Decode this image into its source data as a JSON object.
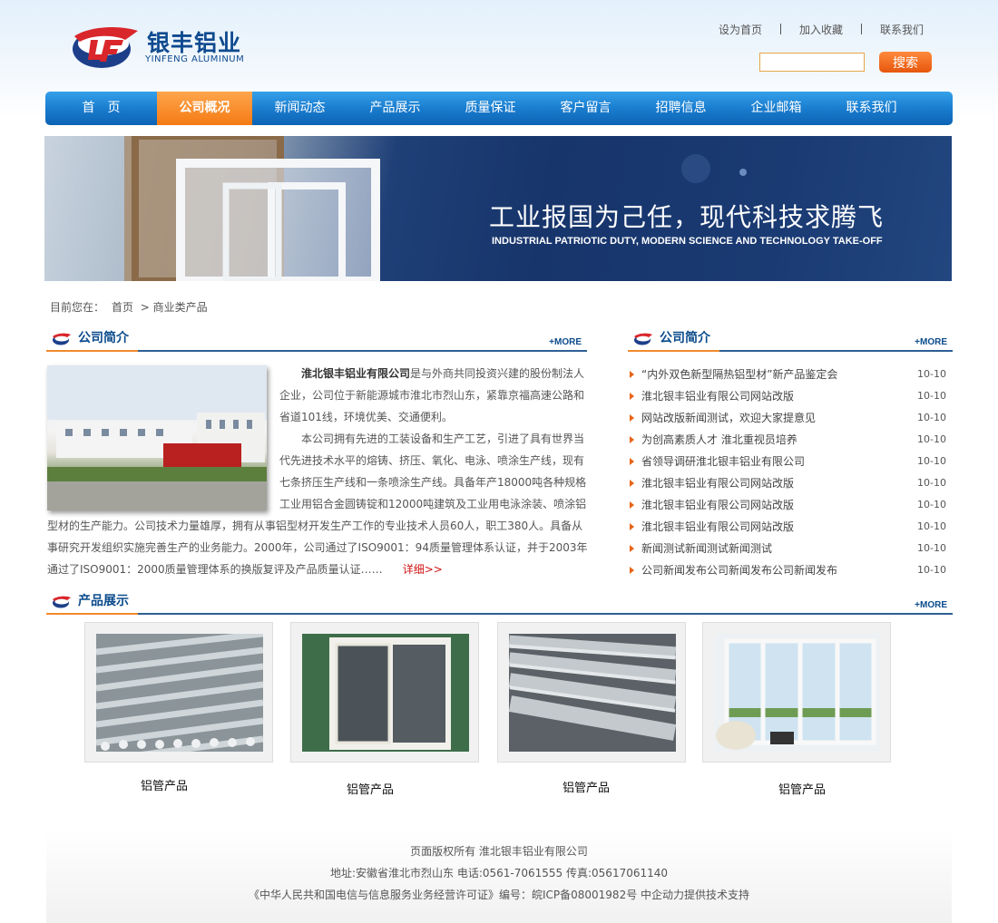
{
  "brand": {
    "name_cn": "银丰铝业",
    "name_en": "YINFENG ALUMINUM"
  },
  "top_links": [
    "设为首页",
    "加入收藏",
    "联系我们"
  ],
  "search": {
    "placeholder": "",
    "button_label": "搜索"
  },
  "nav": {
    "items": [
      "首　页",
      "公司概况",
      "新闻动态",
      "产品展示",
      "质量保证",
      "客户留言",
      "招聘信息",
      "企业邮箱",
      "联系我们"
    ],
    "active_index": 1
  },
  "banner": {
    "title": "工业报国为己任，现代科技求腾飞",
    "subtitle": "INDUSTRIAL PATRIOTIC DUTY, MODERN SCIENCE AND TECHNOLOGY TAKE-OFF"
  },
  "breadcrumb": {
    "label": "目前您在：",
    "home": "首页",
    "sep": ">",
    "current": "商业类产品"
  },
  "intro_section": {
    "title": "公司简介",
    "more": "+MORE",
    "company_name": "淮北银丰铝业有限公司",
    "para1_rest": "是与外商共同投资兴建的股份制法人企业，公司位于新能源城市淮北市烈山东，紧靠京福高速公路和省道101线，环境优美、交通便利。",
    "para2": "本公司拥有先进的工装设备和生产工艺，引进了具有世界当代先进技术水平的熔铸、挤压、氧化、电泳、喷涂生产线，现有七条挤压生产线和一条喷涂生产线。具备年产18000吨各种规格工业用铝合金圆铸锭和12000吨建筑及工业用电泳涂装、喷涂铝型材的生产能力。公司技术力量雄厚，拥有从事铝型材开发生产工作的专业技术人员60人，职工380人。具备从事研究开发组织实施完善生产的业务能力。2000年，公司通过了ISO9001：94质量管理体系认证，并于2003年通过了ISO9001：2000质量管理体系的换版复评及产品质量认证……",
    "detail_link": "详细>>"
  },
  "news_section": {
    "title": "公司简介",
    "more": "+MORE",
    "items": [
      {
        "title": "“内外双色新型隔热铝型材”新产品鉴定会",
        "date": "10-10"
      },
      {
        "title": "淮北银丰铝业有限公司网站改版",
        "date": "10-10"
      },
      {
        "title": "网站改版新闻测试，欢迎大家提意见",
        "date": "10-10"
      },
      {
        "title": "为创高素质人才 淮北重视员培养",
        "date": "10-10"
      },
      {
        "title": "省领导调研淮北银丰铝业有限公司",
        "date": "10-10"
      },
      {
        "title": "淮北银丰铝业有限公司网站改版",
        "date": "10-10"
      },
      {
        "title": "淮北银丰铝业有限公司网站改版",
        "date": "10-10"
      },
      {
        "title": "淮北银丰铝业有限公司网站改版",
        "date": "10-10"
      },
      {
        "title": "新闻测试新闻测试新闻测试",
        "date": "10-10"
      },
      {
        "title": "公司新闻发布公司新闻发布公司新闻发布",
        "date": "10-10"
      }
    ]
  },
  "products_section": {
    "title": "产品展示",
    "more": "+MORE",
    "items": [
      {
        "caption": "铝管产品"
      },
      {
        "caption": "铝管产品"
      },
      {
        "caption": "铝管产品"
      },
      {
        "caption": "铝管产品"
      }
    ]
  },
  "footer": {
    "line1": "页面版权所有 淮北银丰铝业有限公司",
    "line2": "地址:安徽省淮北市烈山东 电话:0561-7061555 传真:05617061140",
    "line3": "《中华人民共和国电信与信息服务业务经营许可证》编号：皖ICP备08001982号 中企动力提供技术支持"
  },
  "colors": {
    "nav_blue": "#1a7dcf",
    "nav_active": "#f47a14",
    "brand_blue": "#0e4a8f",
    "accent_red": "#d01414"
  }
}
